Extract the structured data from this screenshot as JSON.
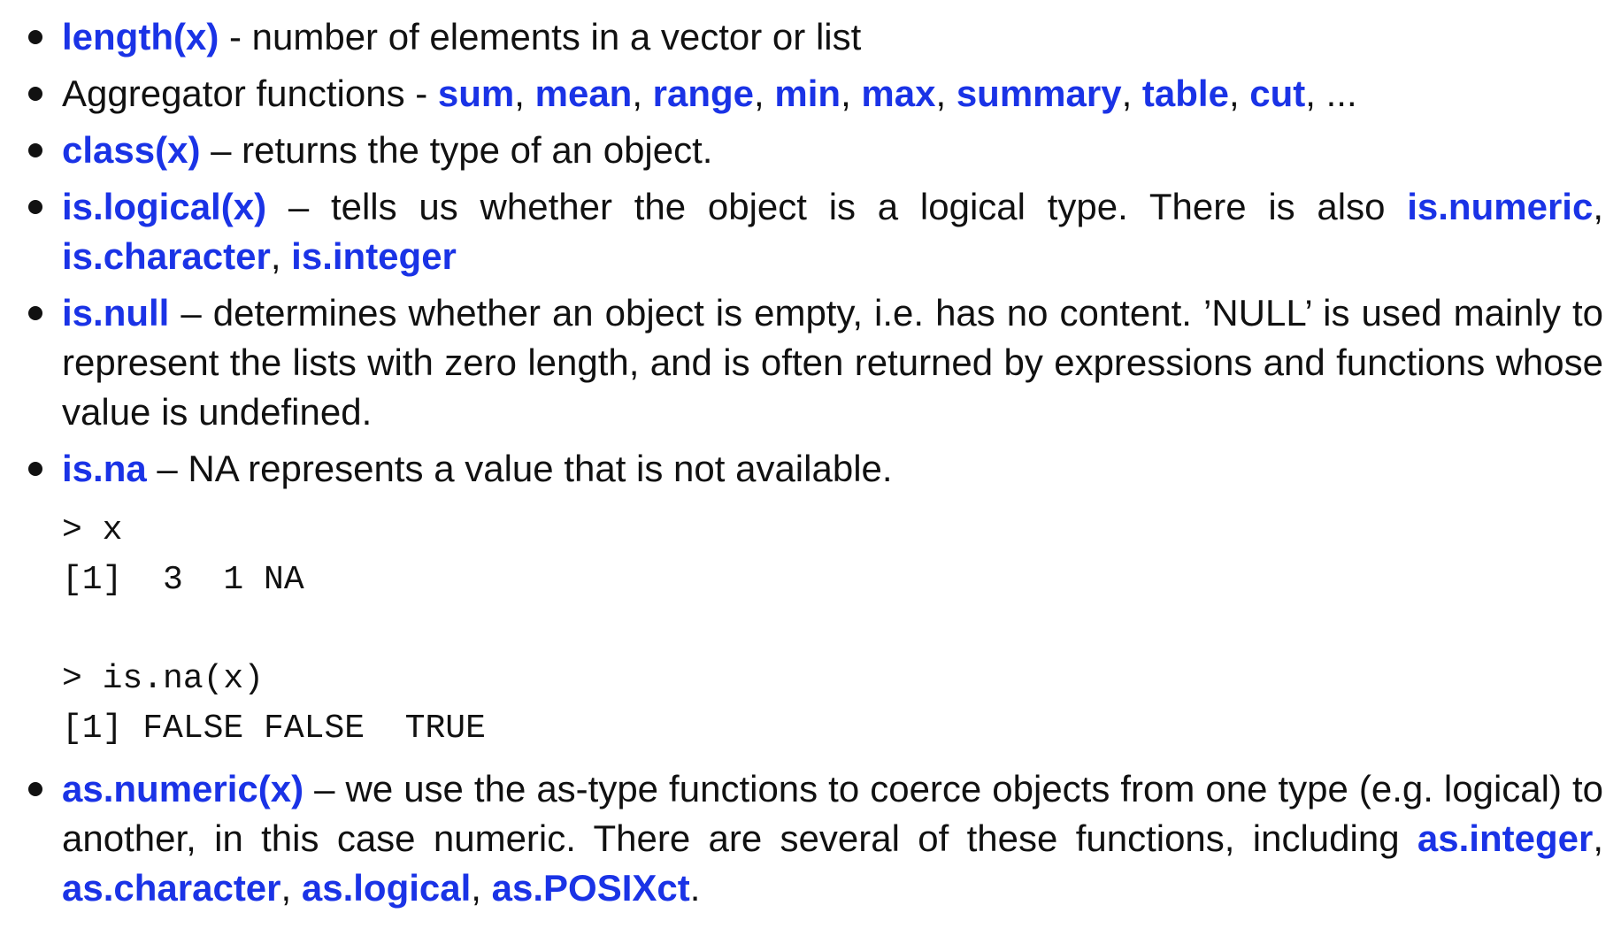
{
  "items": [
    {
      "segments": [
        {
          "text": "length(x)",
          "kw": true
        },
        {
          "text": " - number of elements in a vector or list",
          "kw": false
        }
      ]
    },
    {
      "segments": [
        {
          "text": "Aggregator functions - ",
          "kw": false
        },
        {
          "text": "sum",
          "kw": true
        },
        {
          "text": ", ",
          "kw": false
        },
        {
          "text": "mean",
          "kw": true
        },
        {
          "text": ", ",
          "kw": false
        },
        {
          "text": "range",
          "kw": true
        },
        {
          "text": ", ",
          "kw": false
        },
        {
          "text": "min",
          "kw": true
        },
        {
          "text": ", ",
          "kw": false
        },
        {
          "text": "max",
          "kw": true
        },
        {
          "text": ", ",
          "kw": false
        },
        {
          "text": "summary",
          "kw": true
        },
        {
          "text": ", ",
          "kw": false
        },
        {
          "text": "table",
          "kw": true
        },
        {
          "text": ", ",
          "kw": false
        },
        {
          "text": "cut",
          "kw": true
        },
        {
          "text": ", ...",
          "kw": false
        }
      ]
    },
    {
      "segments": [
        {
          "text": "class(x)",
          "kw": true
        },
        {
          "text": " – returns the type of an object.",
          "kw": false
        }
      ]
    },
    {
      "segments": [
        {
          "text": "is.logical(x)",
          "kw": true
        },
        {
          "text": " – tells us whether the object is a logical type.  There is also ",
          "kw": false
        },
        {
          "text": "is.numeric",
          "kw": true
        },
        {
          "text": ", ",
          "kw": false
        },
        {
          "text": "is.character",
          "kw": true
        },
        {
          "text": ", ",
          "kw": false
        },
        {
          "text": "is.integer",
          "kw": true
        }
      ]
    },
    {
      "segments": [
        {
          "text": "is.null",
          "kw": true
        },
        {
          "text": " – determines whether an object is empty, i.e. has no content. ’NULL’ is used mainly to represent the lists with zero length, and is often returned by expressions and functions whose value is undefined.",
          "kw": false
        }
      ]
    },
    {
      "segments": [
        {
          "text": "is.na",
          "kw": true
        },
        {
          "text": " – NA represents a value that is not available.",
          "kw": false
        }
      ],
      "code": [
        [
          "> x",
          "[1]  3  1 NA"
        ],
        [
          "> is.na(x)",
          "[1] FALSE FALSE  TRUE"
        ]
      ]
    },
    {
      "segments": [
        {
          "text": "as.numeric(x)",
          "kw": true
        },
        {
          "text": " – we use the as-type functions to coerce objects from one type (e.g. logical) to another, in this case numeric. There are several of these functions, including ",
          "kw": false
        },
        {
          "text": "as.integer",
          "kw": true
        },
        {
          "text": ", ",
          "kw": false
        },
        {
          "text": "as.character",
          "kw": true
        },
        {
          "text": ", ",
          "kw": false
        },
        {
          "text": "as.logical",
          "kw": true
        },
        {
          "text": ", ",
          "kw": false
        },
        {
          "text": "as.POSIXct",
          "kw": true
        },
        {
          "text": ".",
          "kw": false
        }
      ]
    }
  ]
}
